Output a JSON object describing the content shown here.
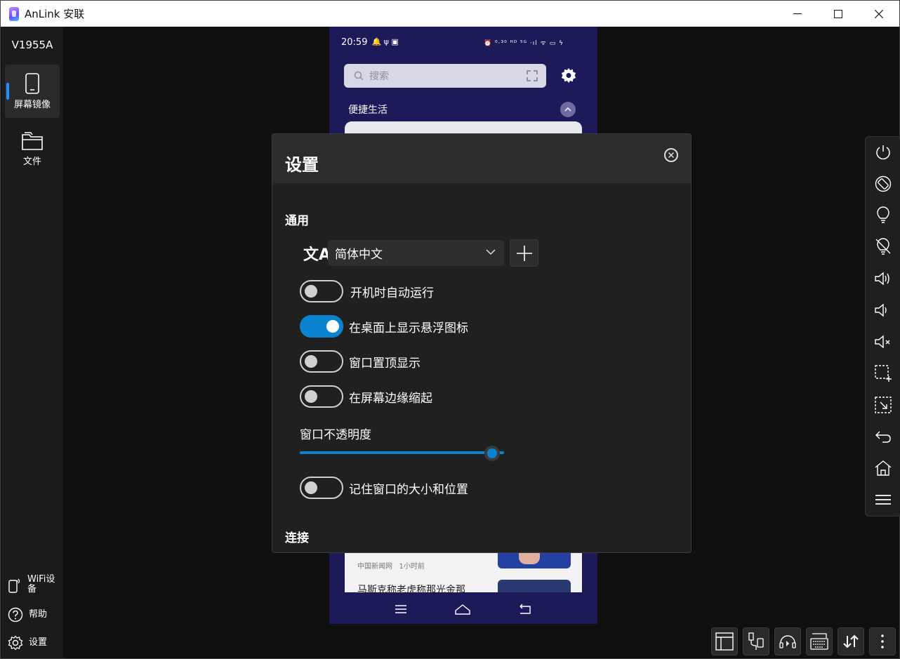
{
  "window": {
    "title": "AnLink 安联",
    "minimize": "—",
    "maximize": "☐",
    "close": "✕"
  },
  "sidebar": {
    "device_name": "V1955A",
    "nav": [
      {
        "label": "屏幕镜像",
        "icon": "phone-icon",
        "active": true
      },
      {
        "label": "文件",
        "icon": "folder-icon",
        "active": false
      }
    ],
    "bottom": [
      {
        "label": "WiFi设备",
        "icon": "wifi-device-icon"
      },
      {
        "label": "帮助",
        "icon": "help-icon"
      },
      {
        "label": "设置",
        "icon": "gear-icon"
      }
    ]
  },
  "phone": {
    "time": "20:59",
    "status_icons": "⏰ ⁰·³⁰ ᴴᴰ ⁵ᴳ ·ıl ᯤ ▭ ϟ",
    "search_placeholder": "搜索",
    "section_title": "便捷生活",
    "news_source": "中国新闻网",
    "news_time": "1小时前",
    "news_title": "马斯克称老虎称那光金那"
  },
  "dialog": {
    "title": "设置",
    "close": "✕",
    "general_label": "通用",
    "language": "简体中文",
    "language_icon": "文A",
    "add": "+",
    "toggles": [
      {
        "label": "开机时自动运行",
        "on": false
      },
      {
        "label": "在桌面上显示悬浮图标",
        "on": true
      },
      {
        "label": "窗口置顶显示",
        "on": false
      },
      {
        "label": "在屏幕边缘缩起",
        "on": false
      }
    ],
    "opacity_label": "窗口不透明度",
    "opacity_value": 0.9,
    "remember_label": "记住窗口的大小和位置",
    "remember_on": false,
    "connection_label": "连接"
  },
  "right_toolbar": [
    "power-icon",
    "rotate-icon",
    "light-on-icon",
    "light-off-icon",
    "volume-up-icon",
    "volume-down-icon",
    "mute-icon",
    "region-screenshot-icon",
    "screenshot-icon",
    "back-icon",
    "home-icon",
    "menu-icon"
  ],
  "bottom_toolbar": [
    "layout-icon",
    "usb-icon",
    "audio-icon",
    "keyboard-icon",
    "transfer-icon",
    "more-icon"
  ]
}
